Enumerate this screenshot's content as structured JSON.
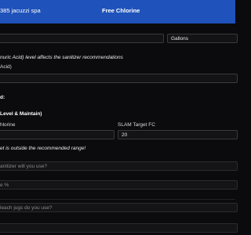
{
  "header": {
    "device_label": "385 jacuzzi spa",
    "screen_title": "Free Chlorine"
  },
  "volume": {
    "unit_value": "Gallons"
  },
  "cya": {
    "note": "nuric Acid) level affects the sanitizer recommendations",
    "field_label": "Acid)"
  },
  "targets": {
    "section_heading": "d:",
    "mode_heading": "Level & Maintain)",
    "chlorine_label": "hlorine",
    "slam_label": "SLAM Target FC",
    "slam_value": "20",
    "warning": "et is outside the recommended range!"
  },
  "sanitizer": {
    "question": "anitizer will you use?",
    "percent_label": "e %",
    "jugs_question": "leach jugs do you use?"
  }
}
